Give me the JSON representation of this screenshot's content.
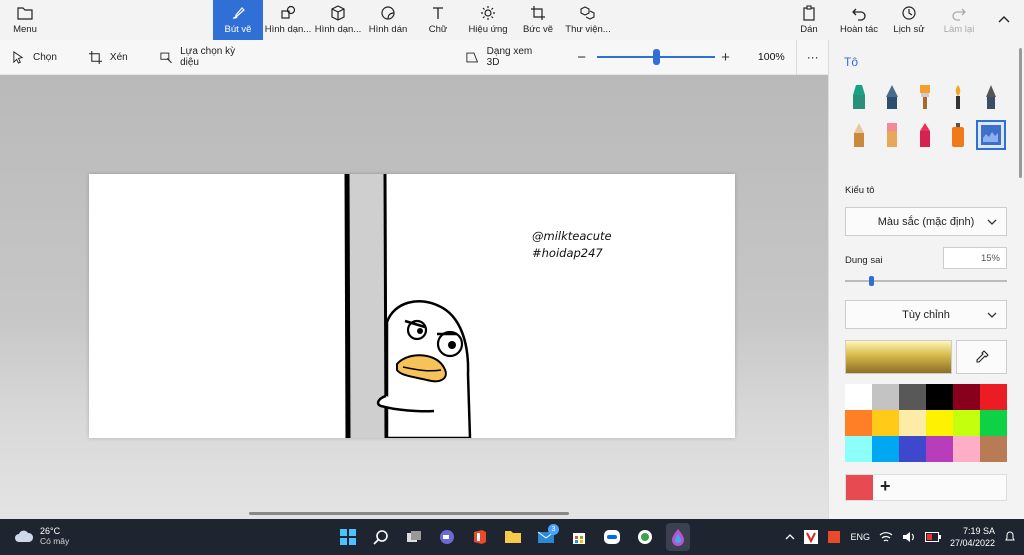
{
  "toolbar": {
    "menu_label": "Menu",
    "tools": [
      {
        "label": "Bút vẽ"
      },
      {
        "label": "Hình dạn..."
      },
      {
        "label": "Hình dạn..."
      },
      {
        "label": "Hình dán"
      },
      {
        "label": "Chữ"
      },
      {
        "label": "Hiệu ứng"
      },
      {
        "label": "Bức vẽ"
      },
      {
        "label": "Thư viện..."
      }
    ],
    "paste_label": "Dán",
    "undo_label": "Hoàn tác",
    "history_label": "Lịch sử",
    "redo_label": "Làm lại"
  },
  "subbar": {
    "select_label": "Chọn",
    "crop_label": "Xén",
    "magic_select_label": "Lựa chọn kỳ diệu",
    "view3d_label": "Dạng xem 3D",
    "zoom_percent": "100%",
    "zoom_value": 0.5,
    "more_label": "···"
  },
  "canvas": {
    "line1": "@milkteacute",
    "line2": "#hoidap247"
  },
  "panel": {
    "title": "Tô",
    "brush_type_label": "Kiểu tô",
    "brush_type_value": "Màu sắc (mặc định)",
    "tolerance_label": "Dung sai",
    "tolerance_value": "15%",
    "tolerance_level": 0.15,
    "custom_label": "Tùy chỉnh",
    "colors": {
      "current_gold": "#d8b94a",
      "custom_swatch": "#e84a52",
      "palette": [
        "#ffffff",
        "#c3c3c3",
        "#585858",
        "#000000",
        "#88001b",
        "#ec1c24",
        "#ff7f27",
        "#ffca18",
        "#fdeca6",
        "#fff200",
        "#c4ff0e",
        "#0ed145",
        "#8cfffb",
        "#00a8f3",
        "#3f48cc",
        "#b83dba",
        "#ffaec8",
        "#b97a56"
      ]
    }
  },
  "taskbar": {
    "temp": "26°C",
    "weather_desc": "Có mây",
    "mail_badge": "3",
    "lang": "ENG",
    "time": "7:19 SA",
    "date": "27/04/2022"
  }
}
